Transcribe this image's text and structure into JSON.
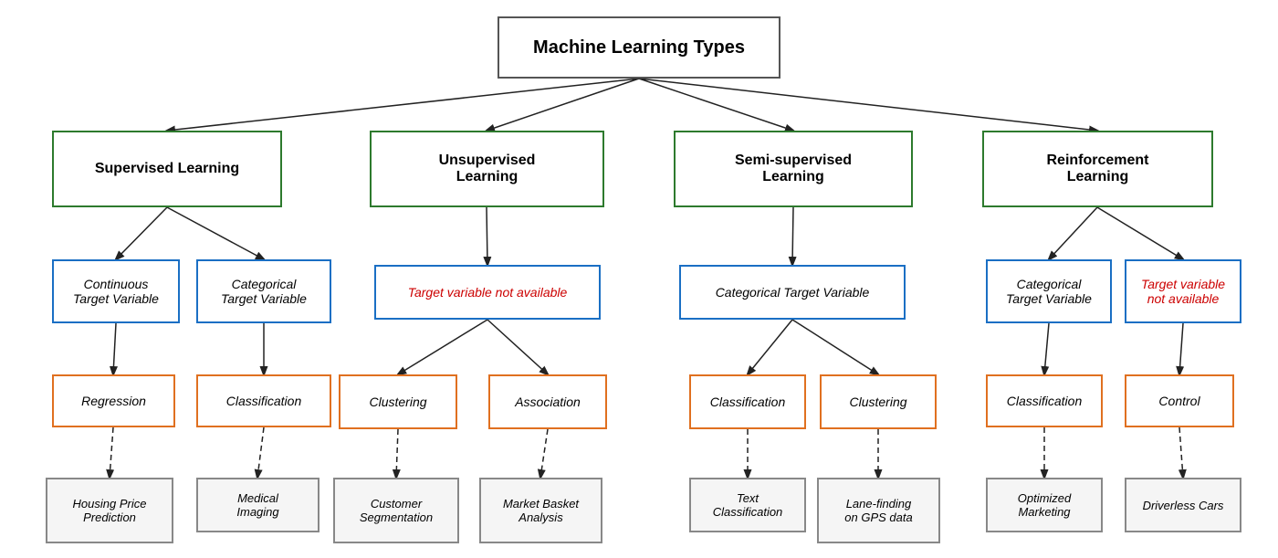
{
  "title": "Machine Learning Types",
  "nodes": {
    "root": "Machine Learning Types",
    "supervised": "Supervised Learning",
    "unsupervised": "Unsupervised\nLearning",
    "semisupervised": "Semi-supervised\nLearning",
    "reinforcement": "Reinforcement\nLearning",
    "continuous": "Continuous\nTarget Variable",
    "categorical_s": "Categorical\nTarget Variable",
    "target_na": "Target variable not available",
    "categorical_semi": "Categorical Target Variable",
    "categorical_r": "Categorical\nTarget Variable",
    "target_na_r": "Target variable\nnot available",
    "regression": "Regression",
    "classification_s": "Classification",
    "clustering_u": "Clustering",
    "association": "Association",
    "classification_semi": "Classification",
    "clustering_semi": "Clustering",
    "classification_r": "Classification",
    "control": "Control",
    "housing": "Housing Price\nPrediction",
    "medical": "Medical\nImaging",
    "customer": "Customer\nSegmentation",
    "market": "Market Basket\nAnalysis",
    "text": "Text\nClassification",
    "lane": "Lane-finding\non GPS data",
    "optimized": "Optimized\nMarketing",
    "driverless": "Driverless Cars"
  }
}
